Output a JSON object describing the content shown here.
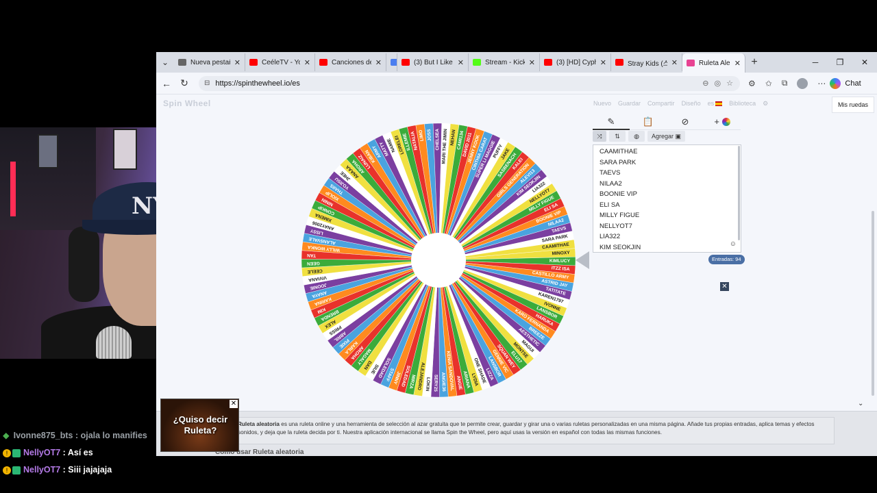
{
  "tabs": [
    {
      "label": "Nueva pestaña",
      "color": "#666666"
    },
    {
      "label": "CeéleTV - YouT",
      "color": "#ff0000"
    },
    {
      "label": "Canciones de c",
      "color": "#ff0000"
    },
    {
      "label": "",
      "color": "#4a7ef0"
    },
    {
      "label": "(3) But I Like Yo",
      "color": "#ff0000"
    },
    {
      "label": "Stream - Kick D",
      "color": "#53fc18"
    },
    {
      "label": "(3) [HD] Cyphe",
      "color": "#ff0000"
    },
    {
      "label": "Stray Kids (스트",
      "color": "#ff0000"
    },
    {
      "label": "Ruleta Aleator",
      "color": "#e84393"
    }
  ],
  "address": {
    "url": "https://spinthewheel.io/es"
  },
  "toolbar": {
    "chat_label": "Chat"
  },
  "site": {
    "logo": "Spin Wheel",
    "menu": [
      "Nuevo",
      "Guardar",
      "Compartir",
      "Diseño",
      "es",
      "Biblioteca"
    ],
    "mis_ruedas": "Mis ruedas",
    "agregar": "Agregar",
    "entries_count": "Entradas: 94",
    "visible_entries": [
      "CAAMITHAE",
      "SARA PARK",
      "TAEVS",
      "NILAA2",
      "BOONIE VIP",
      "ELI SA",
      "MILLY FIGUE",
      "NELLYOT7",
      "LIA322",
      "KIM SEOKJIN"
    ],
    "description_bold": "Ruleta aleatoria",
    "description": "es una ruleta online y una herramienta de selección al azar gratuita que te permite crear, guardar y girar una o varias ruletas personalizadas en una misma página. Añade tus propias entradas, aplica temas y efectos sonidos, y deja que la ruleta decida por ti. Nuestra aplicación internacional se llama Spin the Wheel, pero aquí usas la versión en español con todas las mismas funciones.",
    "how_to": "Cómo usar Ruleta aleatoria"
  },
  "wheel": {
    "colors": [
      "#f0e040",
      "#3bab3b",
      "#e8322b",
      "#ff8a1f",
      "#4aa3df",
      "#7b3fa0",
      "#ffffff"
    ],
    "names": [
      "MINOXY",
      "KIMLUCY",
      "ITZZ ISA",
      "CASTILLO ARMY",
      "ASTRID JAY",
      "TATITATE",
      "KAREN1797",
      "IVONNE",
      "LANSBOR",
      "HARUKA",
      "KARO FERNANDA",
      "BREEZE",
      "AESTHETIC",
      "MAGUI",
      "MONTSE",
      "ELU17",
      "SQUAN WEY",
      "GENNIE VIC",
      "LANSBOR",
      "LIZZA",
      "ONE SHADE",
      "LYDIA",
      "ARIANA",
      "ANGIE",
      "KENIA SANDOVAL",
      "ANGIE36",
      "SERY25",
      "LOKIN",
      "ALEJANDRO",
      "MIRZA",
      "SOLEDAD",
      "JINNY",
      "STAFF",
      "SOLEDAD",
      "SIUE",
      "DAN",
      "MAGALY",
      "AROHA",
      "KARLA",
      "PIXIE",
      "ABRIL",
      "PRISS",
      "ALEX",
      "BRENDA",
      "KIM",
      "KARINA",
      "ANAYA",
      "JOONIE",
      "VIVIANA",
      "CEELE",
      "GEEN",
      "TAN",
      "WILLY WONKA",
      "ALANSVALE",
      "LISSY",
      "ANAY2006",
      "XIMENA",
      "CONKIP",
      "NININ",
      "XIOLIP",
      "THAIIS",
      "YOJISU",
      "JHEE",
      "ANAAA",
      "AROHA",
      "LUNAIZ",
      "KIBAN",
      "ARMY",
      "MATTY",
      "NAMIE",
      "LORELEI",
      "ILLEMIE",
      "NATALIA",
      "LIMO",
      "JOSS",
      "CHELSEA",
      "MARI THE JIMIN",
      "NEHAN",
      "CAMI134",
      "DAVID 2011",
      "JENNY KOOK",
      "CINTHIA CARAT",
      "SUPER LI MAGGIE",
      "PUFFY",
      "JAKE",
      "SASBENACH",
      "KALEI",
      "GIRLS GENERATION",
      "ALEVI13",
      "KIM SEOKJIN",
      "LIA322",
      "NELLYOT7",
      "MILLY FIGUE",
      "ELI SA",
      "BOONIE VIP",
      "NILAA2",
      "TAEVS",
      "SARA PARK",
      "CAAMITHAE"
    ]
  },
  "overlay": {
    "line1": "¿Quiso decir",
    "line2": "Ruleta?"
  },
  "chat": [
    {
      "user": "Ivonne875_bts",
      "message": ": ojala lo manifies"
    },
    {
      "user": "NellyOT7",
      "message": ": Así es"
    },
    {
      "user": "NellyOT7",
      "message": ": Siii jajajaja"
    }
  ]
}
